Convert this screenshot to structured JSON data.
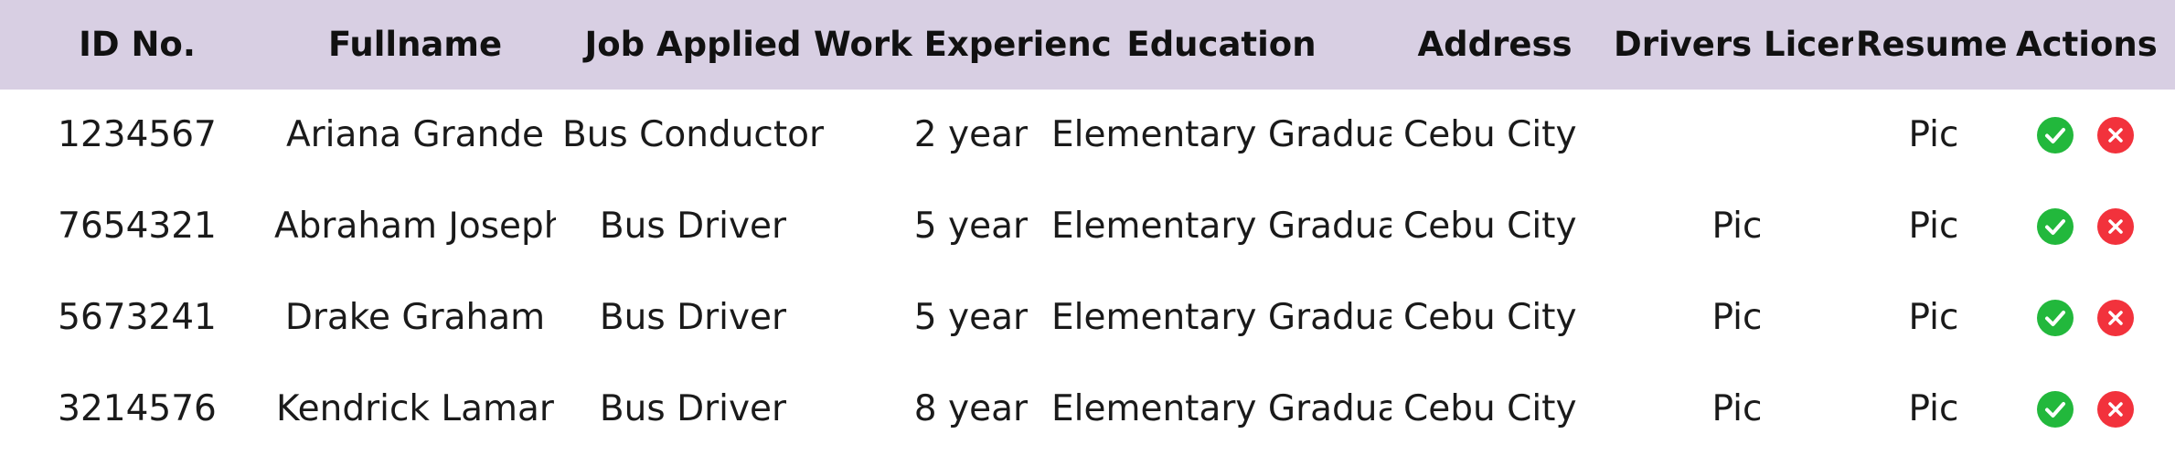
{
  "columns": {
    "id": "ID No.",
    "fullname": "Fullname",
    "job": "Job Applied",
    "experience": "Work Experience",
    "education": "Education",
    "address": "Address",
    "license": "Drivers License",
    "resume": "Resume",
    "actions": "Actions"
  },
  "colors": {
    "header_bg": "#d8cfe3",
    "accept": "#22b83c",
    "reject": "#f2323c"
  },
  "icons": {
    "accept": "check-circle-icon",
    "reject": "x-circle-icon"
  },
  "rows": [
    {
      "id": "1234567",
      "fullname": "Ariana Grande",
      "job": "Bus Conductor",
      "experience": "2 year",
      "education": "Elementary Graduate",
      "address": "Cebu City",
      "license": "",
      "resume": "Pic"
    },
    {
      "id": "7654321",
      "fullname": "Abraham Joseph",
      "job": "Bus Driver",
      "experience": "5 year",
      "education": "Elementary Graduate",
      "address": "Cebu City",
      "license": "Pic",
      "resume": "Pic"
    },
    {
      "id": "5673241",
      "fullname": "Drake Graham",
      "job": "Bus Driver",
      "experience": "5 year",
      "education": "Elementary Graduate",
      "address": "Cebu City",
      "license": "Pic",
      "resume": "Pic"
    },
    {
      "id": "3214576",
      "fullname": "Kendrick Lamar",
      "job": "Bus Driver",
      "experience": "8 year",
      "education": "Elementary Graduate",
      "address": "Cebu City",
      "license": "Pic",
      "resume": "Pic"
    }
  ]
}
